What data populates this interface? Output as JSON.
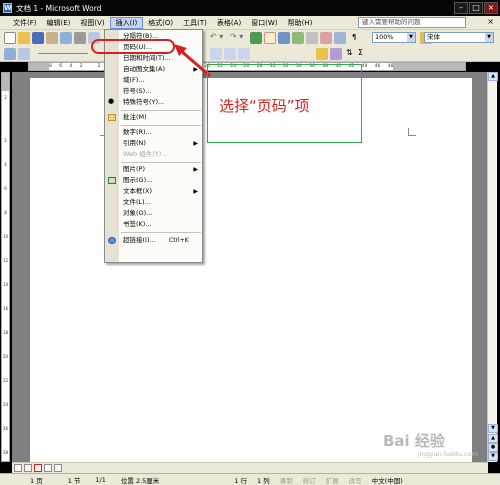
{
  "window": {
    "title": "文档 1 - Microsoft Word",
    "app_icon": "W"
  },
  "menubar": {
    "items": [
      "文件(F)",
      "编辑(E)",
      "视图(V)",
      "插入(I)",
      "格式(O)",
      "工具(T)",
      "表格(A)",
      "窗口(W)",
      "帮助(H)"
    ],
    "help_placeholder": "键入需要帮助的问题",
    "close": "×"
  },
  "toolbar": {
    "zoom": "100%",
    "font": "宋体"
  },
  "ruler": {
    "h_numbers": [
      "8",
      "6",
      "4",
      "2",
      "",
      "2",
      "4",
      "6",
      "8",
      "10",
      "12",
      "14",
      "16",
      "18",
      "20",
      "22",
      "24",
      "26",
      "28",
      "30",
      "32",
      "34",
      "36",
      "38",
      "40",
      "42",
      "44",
      "46",
      "48"
    ],
    "v_numbers": [
      "2",
      "",
      "2",
      "4",
      "6",
      "8",
      "10",
      "12",
      "14",
      "16",
      "18",
      "20",
      "22",
      "24",
      "26",
      "28"
    ]
  },
  "insert_menu": {
    "items": [
      {
        "label": "分隔符(B)..."
      },
      {
        "label": "页码(U)..."
      },
      {
        "label": "日期和时间(T)..."
      },
      {
        "label": "自动图文集(A)",
        "submenu": "▶"
      },
      {
        "label": "域(F)..."
      },
      {
        "label": "符号(S)..."
      },
      {
        "label": "特殊符号(Y)..."
      },
      {
        "label": "批注(M)"
      },
      {
        "label": "数字(R)..."
      },
      {
        "label": "引用(N)",
        "submenu": "▶"
      },
      {
        "label": "Web 组件(Y)..."
      },
      {
        "label": "图片(P)",
        "submenu": "▶"
      },
      {
        "label": "图示(G)..."
      },
      {
        "label": "文本框(X)",
        "submenu": "▶"
      },
      {
        "label": "文件(L)..."
      },
      {
        "label": "对象(O)..."
      },
      {
        "label": "书签(K)..."
      },
      {
        "label": "超链接(I)...",
        "shortcut": "Ctrl+K"
      }
    ]
  },
  "annotation": {
    "text": "选择“页码”项"
  },
  "statusbar": {
    "page": "1 页",
    "section": "1 节",
    "pages": "1/1",
    "position": "位置 2.5厘米",
    "line": "1 行",
    "column": "1 列",
    "rec": "录制",
    "trk": "修订",
    "ext": "扩展",
    "ovr": "改写",
    "language": "中文(中国)"
  },
  "watermark": {
    "logo": "Bai 经验",
    "url": "jingyan.baidu.com"
  },
  "colors": {
    "accent_red": "#d91f1f",
    "annotation_green": "#33a852",
    "menu_bg": "#ece9d8"
  }
}
